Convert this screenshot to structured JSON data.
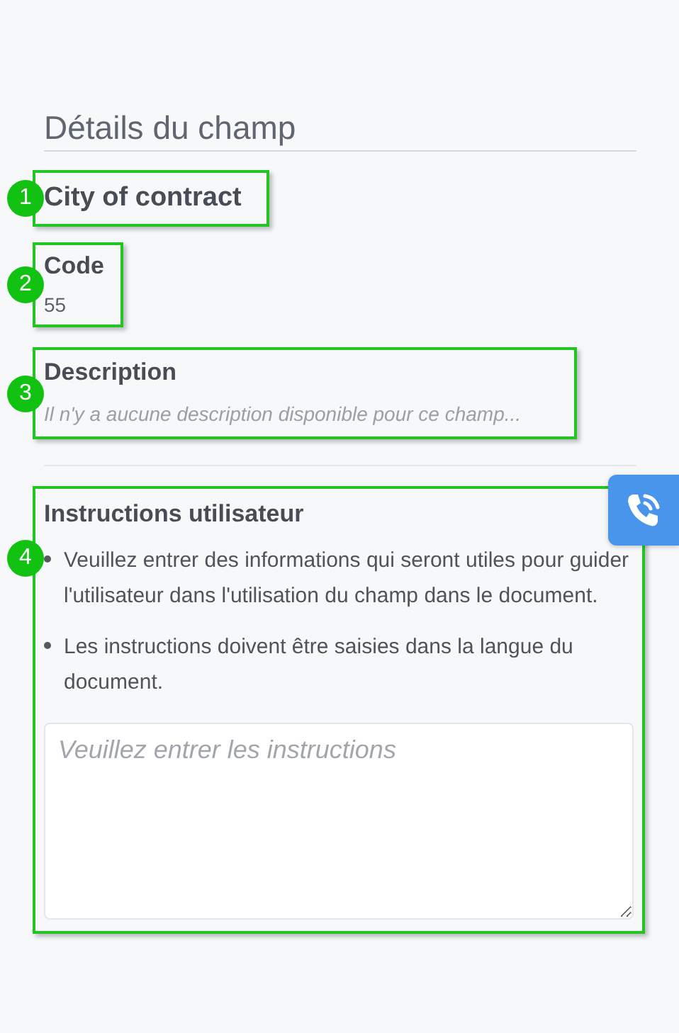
{
  "page_title": "Détails du champ",
  "field_name": "City of contract",
  "code": {
    "label": "Code",
    "value": "55"
  },
  "description": {
    "label": "Description",
    "empty_text": "Il n'y a aucune description disponible pour ce champ..."
  },
  "instructions": {
    "label": "Instructions utilisateur",
    "bullets": [
      "Veuillez entrer des informations qui seront utiles pour guider l'utilisateur dans l'utilisation du champ dans le document.",
      "Les instructions doivent être saisies dans la langue du document."
    ],
    "input": {
      "placeholder": "Veuillez entrer les instructions"
    }
  },
  "callouts": [
    "1",
    "2",
    "3",
    "4"
  ]
}
